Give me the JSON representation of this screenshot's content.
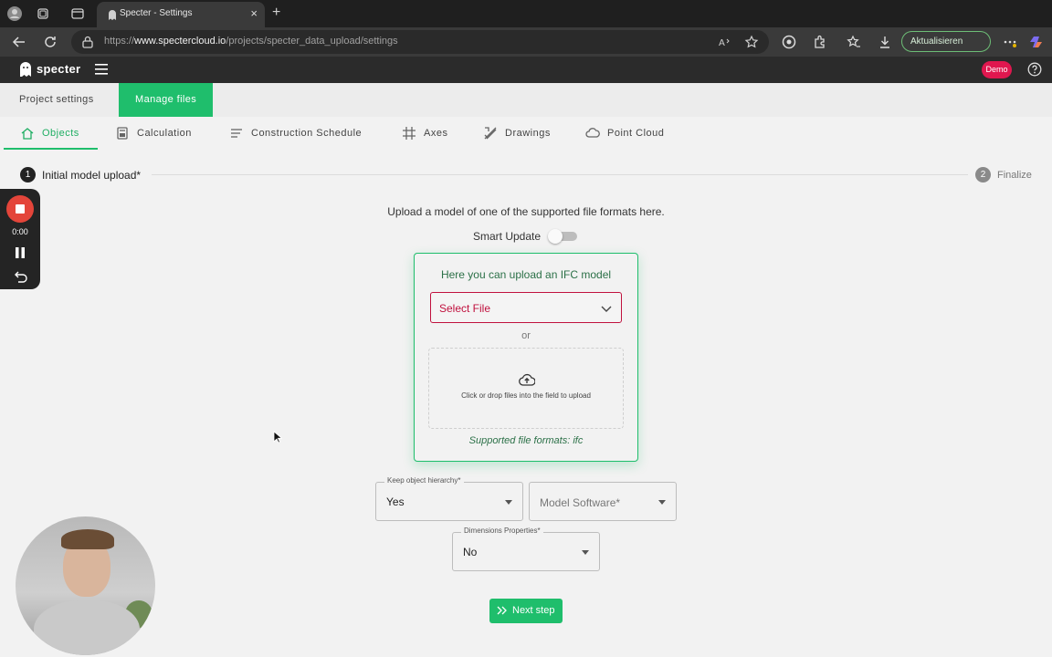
{
  "browser": {
    "tab_title": "Specter - Settings",
    "tab_close": "×",
    "new_tab": "+",
    "url_prefix": "https://",
    "url_host": "www.spectercloud.io",
    "url_path": "/projects/specter_data_upload/settings",
    "update_button": "Aktualisieren"
  },
  "app": {
    "logo_text": "specter",
    "demo_badge": "Demo"
  },
  "subnav": {
    "tabs": [
      {
        "label": "Project settings"
      },
      {
        "label": "Manage files"
      }
    ],
    "active": "Manage files"
  },
  "file_tabs": [
    {
      "label": "Objects",
      "icon": "home-icon"
    },
    {
      "label": "Calculation",
      "icon": "calculator-icon"
    },
    {
      "label": "Construction Schedule",
      "icon": "lines-icon"
    },
    {
      "label": "Axes",
      "icon": "grid-icon"
    },
    {
      "label": "Drawings",
      "icon": "ruler-pencil-icon"
    },
    {
      "label": "Point Cloud",
      "icon": "cloud-icon"
    }
  ],
  "stepper": {
    "step1_num": "1",
    "step1_label": "Initial model upload*",
    "step2_num": "2",
    "step2_label": "Finalize"
  },
  "recorder": {
    "time": "0:00"
  },
  "upload": {
    "intro": "Upload a model of one of the supported file formats here.",
    "smart_update_label": "Smart Update",
    "smart_update_on": false,
    "card_title": "Here you can upload an IFC model",
    "select_placeholder": "Select File",
    "or_text": "or",
    "dropzone_text": "Click or drop files into the field to upload",
    "formats": "Supported file formats: ifc"
  },
  "form": {
    "hierarchy_label": "Keep object hierarchy*",
    "hierarchy_value": "Yes",
    "software_placeholder": "Model Software*",
    "dimensions_label": "Dimensions Properties*",
    "dimensions_value": "No"
  },
  "next_button": "Next step",
  "colors": {
    "accent": "#1fbe6c",
    "error": "#c0113e",
    "demo": "#e0174f"
  }
}
